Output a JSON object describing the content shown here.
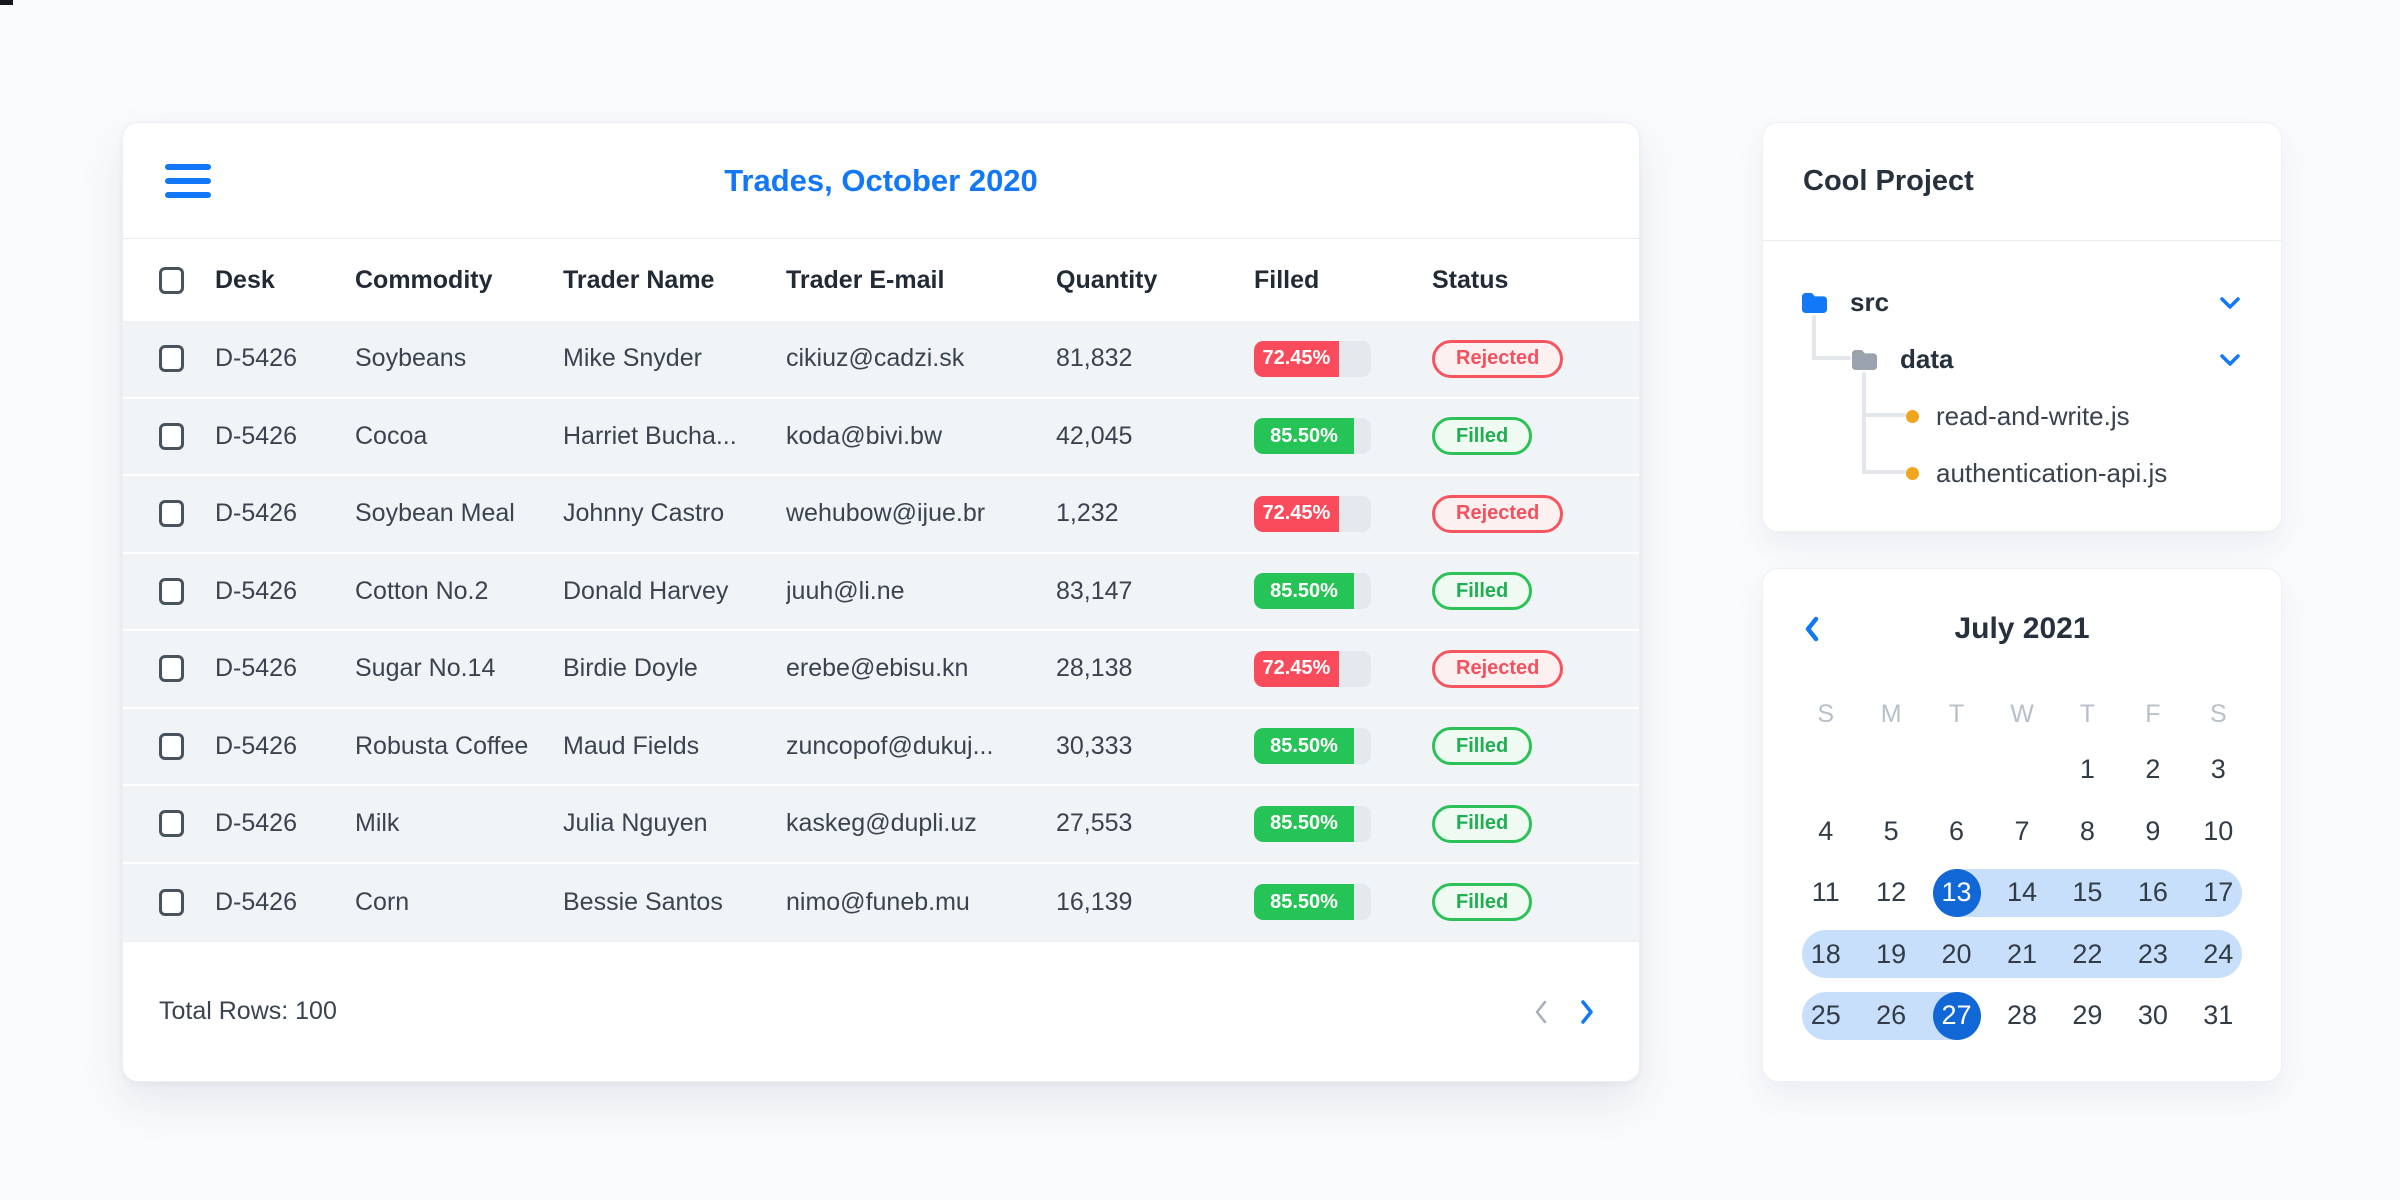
{
  "trades_card": {
    "menu_icon": "menu-icon",
    "title": "Trades, October 2020",
    "columns": [
      "Desk",
      "Commodity",
      "Trader Name",
      "Trader E-mail",
      "Quantity",
      "Filled",
      "Status"
    ],
    "rows": [
      {
        "desk": "D-5426",
        "commodity": "Soybeans",
        "trader": "Mike Snyder",
        "email": "cikiuz@cadzi.sk",
        "quantity": "81,832",
        "filled_pct": "72.45%",
        "filled_value": 72.45,
        "status": "Rejected"
      },
      {
        "desk": "D-5426",
        "commodity": "Cocoa",
        "trader": "Harriet Bucha...",
        "email": "koda@bivi.bw",
        "quantity": "42,045",
        "filled_pct": "85.50%",
        "filled_value": 85.5,
        "status": "Filled"
      },
      {
        "desk": "D-5426",
        "commodity": "Soybean Meal",
        "trader": "Johnny Castro",
        "email": "wehubow@ijue.br",
        "quantity": "1,232",
        "filled_pct": "72.45%",
        "filled_value": 72.45,
        "status": "Rejected"
      },
      {
        "desk": "D-5426",
        "commodity": "Cotton No.2",
        "trader": "Donald Harvey",
        "email": "juuh@li.ne",
        "quantity": "83,147",
        "filled_pct": "85.50%",
        "filled_value": 85.5,
        "status": "Filled"
      },
      {
        "desk": "D-5426",
        "commodity": "Sugar No.14",
        "trader": "Birdie Doyle",
        "email": "erebe@ebisu.kn",
        "quantity": "28,138",
        "filled_pct": "72.45%",
        "filled_value": 72.45,
        "status": "Rejected"
      },
      {
        "desk": "D-5426",
        "commodity": "Robusta Coffee",
        "trader": "Maud Fields",
        "email": "zuncopof@dukuj...",
        "quantity": "30,333",
        "filled_pct": "85.50%",
        "filled_value": 85.5,
        "status": "Filled"
      },
      {
        "desk": "D-5426",
        "commodity": "Milk",
        "trader": "Julia Nguyen",
        "email": "kaskeg@dupli.uz",
        "quantity": "27,553",
        "filled_pct": "85.50%",
        "filled_value": 85.5,
        "status": "Filled"
      },
      {
        "desk": "D-5426",
        "commodity": "Corn",
        "trader": "Bessie Santos",
        "email": "nimo@funeb.mu",
        "quantity": "16,139",
        "filled_pct": "85.50%",
        "filled_value": 85.5,
        "status": "Filled"
      }
    ],
    "footer": {
      "total_rows_label": "Total Rows: 100",
      "prev_icon": "chevron-left-icon",
      "next_icon": "chevron-right-icon"
    }
  },
  "project_card": {
    "title": "Cool Project",
    "items": [
      {
        "label": "src",
        "type": "folder",
        "icon": "folder-icon",
        "icon_color": "#1278f7",
        "expand_icon": "chevron-down-icon"
      },
      {
        "label": "data",
        "type": "folder",
        "icon": "folder-icon",
        "icon_color": "#9ba3ae",
        "expand_icon": "chevron-down-icon"
      },
      {
        "label": "read-and-write.js",
        "type": "file",
        "icon": "file-dot-icon",
        "icon_color": "#f0a51f"
      },
      {
        "label": "authentication-api.js",
        "type": "file",
        "icon": "file-dot-icon",
        "icon_color": "#f0a51f"
      }
    ]
  },
  "calendar_card": {
    "prev_icon": "chevron-left-icon",
    "title": "July 2021",
    "weekdays": [
      "S",
      "M",
      "T",
      "W",
      "T",
      "F",
      "S"
    ],
    "day_numbers": [
      "1",
      "2",
      "3",
      "4",
      "5",
      "6",
      "7",
      "8",
      "9",
      "10",
      "11",
      "12",
      "13",
      "14",
      "15",
      "16",
      "17",
      "18",
      "19",
      "20",
      "21",
      "22",
      "23",
      "24",
      "25",
      "26",
      "27",
      "28",
      "29",
      "30",
      "31"
    ],
    "first_day_column": 4,
    "days_in_month": 31,
    "selected_days": [
      13,
      27
    ],
    "highlight_ranges": [
      [
        13,
        17
      ],
      [
        18,
        24
      ],
      [
        25,
        27
      ]
    ]
  },
  "colors": {
    "accent_blue": "#1278f7",
    "selected_day_blue": "#1167d6",
    "range_blue": "#c7dffa",
    "rejected_red": "#fa4b5c",
    "filled_green": "#26c356",
    "row_bg": "#f0f4f7",
    "folder_gray": "#9ba3ae",
    "file_dot_orange": "#f0a51f"
  }
}
